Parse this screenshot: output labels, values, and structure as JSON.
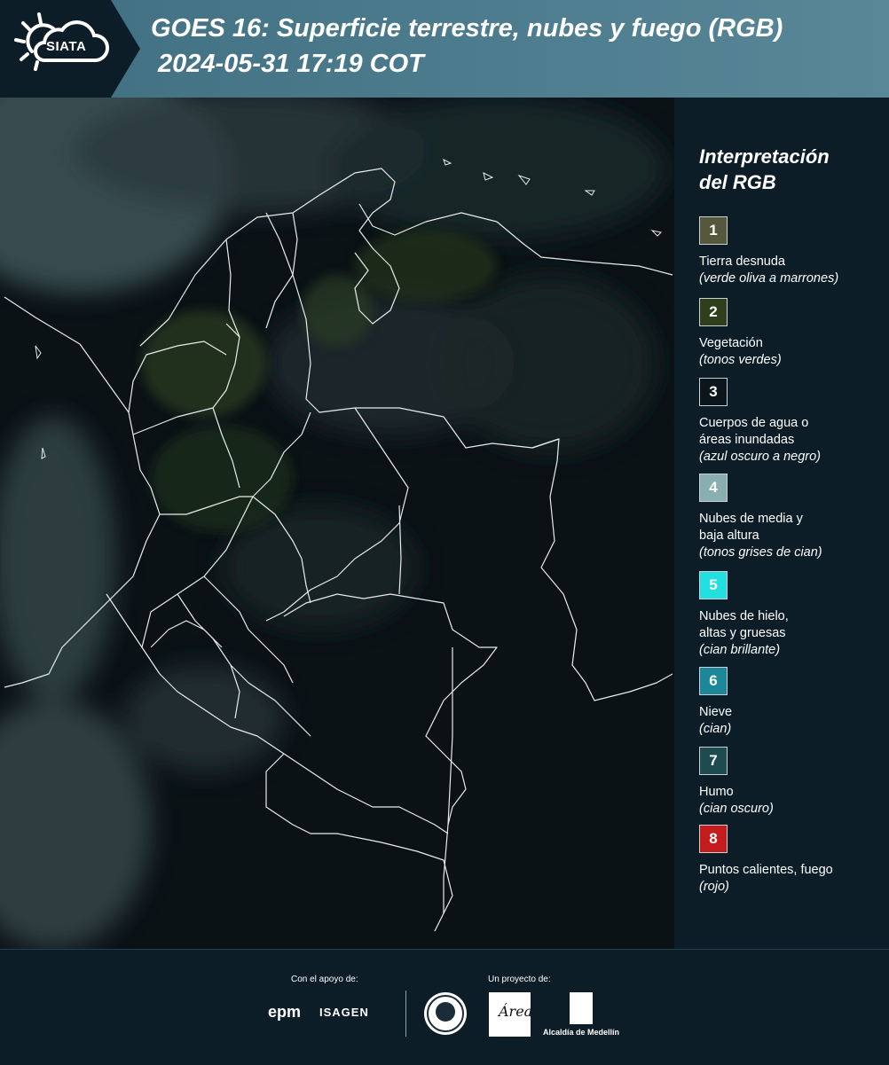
{
  "header": {
    "logo_text": "SIATA",
    "title": "GOES 16: Superficie terrestre, nubes y fuego (RGB)",
    "subtitle": "2024-05-31 17:19 COT"
  },
  "legend": {
    "title_line1": "Interpretación",
    "title_line2": "del RGB",
    "items": [
      {
        "number": "1",
        "color": "#55583c",
        "label_line1": "Tierra desnuda",
        "label_line2": "",
        "desc": "(verde oliva a marrones)"
      },
      {
        "number": "2",
        "color": "#2e3f1c",
        "label_line1": "Vegetación",
        "label_line2": "",
        "desc": "(tonos verdes)"
      },
      {
        "number": "3",
        "color": "#0b151b",
        "label_line1": "Cuerpos de agua o",
        "label_line2": "áreas inundadas",
        "desc": "(azul oscuro a negro)"
      },
      {
        "number": "4",
        "color": "#88aeb0",
        "label_line1": "Nubes de media y",
        "label_line2": "baja altura",
        "desc": "(tonos grises de cian)"
      },
      {
        "number": "5",
        "color": "#22e0e0",
        "label_line1": "Nubes de hielo,",
        "label_line2": "altas y gruesas",
        "desc": "(cian brillante)"
      },
      {
        "number": "6",
        "color": "#1d879a",
        "label_line1": "Nieve",
        "label_line2": "",
        "desc": "(cian)"
      },
      {
        "number": "7",
        "color": "#1d4b50",
        "label_line1": "Humo",
        "label_line2": "",
        "desc": "(cian oscuro)"
      },
      {
        "number": "8",
        "color": "#c41c1c",
        "label_line1": "Puntos calientes, fuego",
        "label_line2": "",
        "desc": "(rojo)"
      }
    ]
  },
  "footer": {
    "support_label": "Con el apoyo de:",
    "project_label": "Un proyecto de:",
    "epm_text": "epm",
    "isagen_text": "ISAGEN",
    "area_text": "Área",
    "alcaldia_text": "Alcaldía de Medellín"
  }
}
